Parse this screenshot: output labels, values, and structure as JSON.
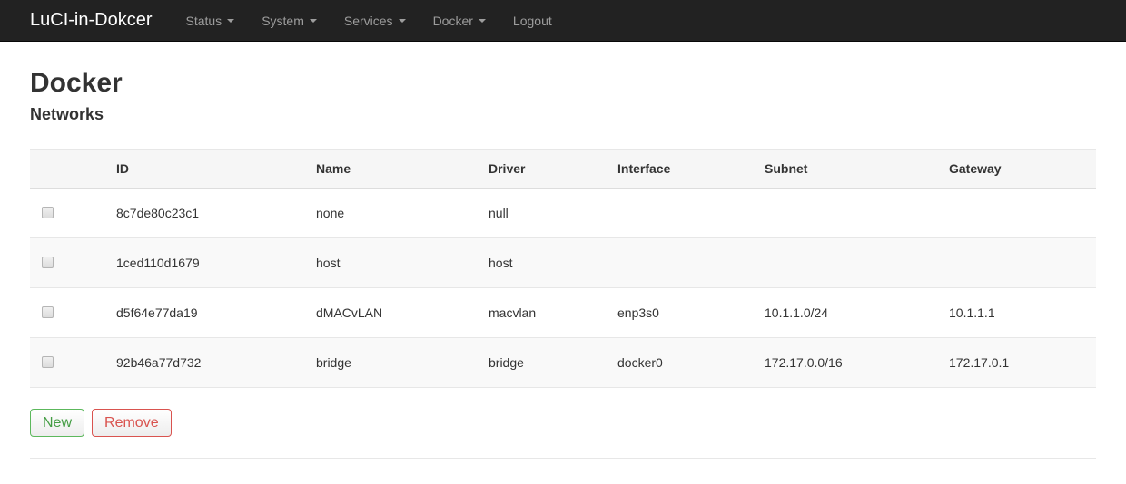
{
  "navbar": {
    "brand": "LuCI-in-Dokcer",
    "items": [
      {
        "label": "Status",
        "dropdown": true
      },
      {
        "label": "System",
        "dropdown": true
      },
      {
        "label": "Services",
        "dropdown": true
      },
      {
        "label": "Docker",
        "dropdown": true
      },
      {
        "label": "Logout",
        "dropdown": false
      }
    ]
  },
  "page": {
    "title": "Docker",
    "section": "Networks"
  },
  "table": {
    "columns": [
      "",
      "ID",
      "Name",
      "Driver",
      "Interface",
      "Subnet",
      "Gateway"
    ],
    "rows": [
      {
        "id": "8c7de80c23c1",
        "name": "none",
        "driver": "null",
        "interface": "",
        "subnet": "",
        "gateway": ""
      },
      {
        "id": "1ced110d1679",
        "name": "host",
        "driver": "host",
        "interface": "",
        "subnet": "",
        "gateway": ""
      },
      {
        "id": "d5f64e77da19",
        "name": "dMACvLAN",
        "driver": "macvlan",
        "interface": "enp3s0",
        "subnet": "10.1.1.0/24",
        "gateway": "10.1.1.1"
      },
      {
        "id": "92b46a77d732",
        "name": "bridge",
        "driver": "bridge",
        "interface": "docker0",
        "subnet": "172.17.0.0/16",
        "gateway": "172.17.0.1"
      }
    ]
  },
  "actions": {
    "new_label": "New",
    "remove_label": "Remove"
  },
  "colors": {
    "navbar_bg": "#222222",
    "nav_link": "#9d9d9d",
    "header_bg": "#f6f6f6",
    "stripe_bg": "#f9f9f9",
    "border": "#e7e7e7",
    "accent_green": "#449d44",
    "accent_red": "#d9534f"
  }
}
